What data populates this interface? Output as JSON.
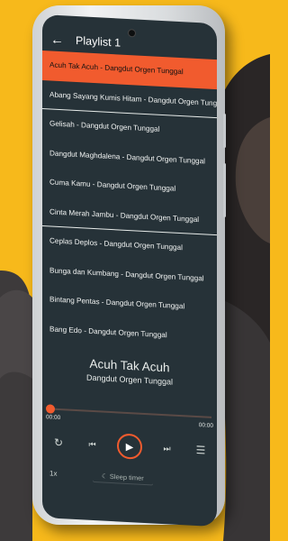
{
  "playlist_title": "Playlist 1",
  "tracks": [
    "Acuh Tak Acuh - Dangdut Orgen Tunggal",
    "Abang Sayang Kumis Hitam - Dangdut Orgen Tunggal",
    "Gelisah - Dangdut Orgen Tunggal",
    "Dangdut Maghdalena - Dangdut Orgen Tunggal",
    "Cuma Kamu - Dangdut Orgen Tunggal",
    "Cinta Merah Jambu - Dangdut Orgen Tunggal",
    "Ceplas Deplos - Dangdut Orgen Tunggal",
    "Bunga dan Kumbang - Dangdut Orgen Tunggal",
    "Bintang Pentas - Dangdut Orgen Tunggal",
    "Bang Edo - Dangdut Orgen Tunggal"
  ],
  "now_playing": {
    "title": "Acuh Tak Acuh",
    "artist": "Dangdut Orgen Tunggal"
  },
  "time_elapsed": "00:00",
  "time_total": "00:00",
  "speed": "1x",
  "sleep_timer_label": "Sleep timer",
  "progress": 0,
  "colors": {
    "accent": "#f15b2e",
    "screen_bg": "#263238",
    "background": "#f7b91b"
  },
  "icons": {
    "back": "back-arrow-icon",
    "repeat": "repeat-icon",
    "previous": "previous-icon",
    "play": "play-icon",
    "next": "next-icon",
    "queue": "queue-icon",
    "moon": "moon-icon"
  }
}
